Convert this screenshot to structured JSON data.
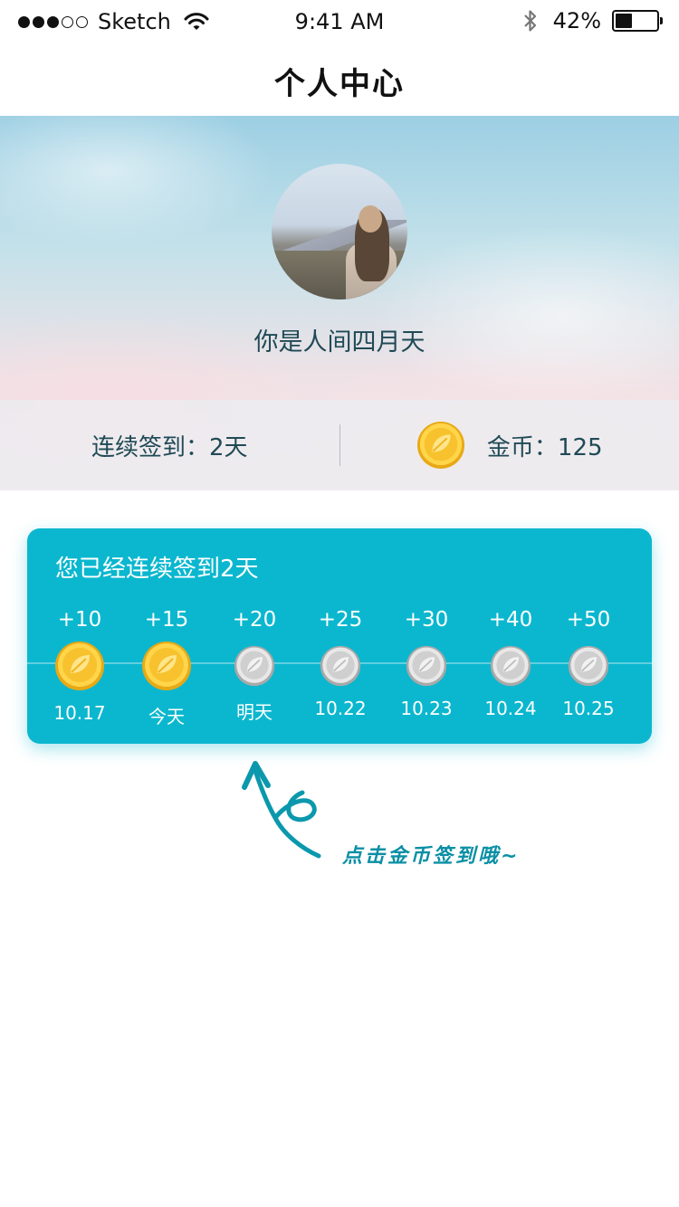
{
  "status_bar": {
    "carrier": "Sketch",
    "time": "9:41 AM",
    "battery": "42%",
    "battery_level": 0.42,
    "signal_bars_filled": 3,
    "signal_bars_total": 5
  },
  "nav": {
    "title": "个人中心"
  },
  "profile": {
    "nickname": "你是人间四月天",
    "checkin_streak_label": "连续签到：2天",
    "coins_label": "金币：125"
  },
  "checkin": {
    "title": "您已经连续签到2天",
    "days": [
      {
        "points": "+10",
        "date": "10.17",
        "claimed": true
      },
      {
        "points": "+15",
        "date": "今天",
        "claimed": true
      },
      {
        "points": "+20",
        "date": "明天",
        "claimed": false
      },
      {
        "points": "+25",
        "date": "10.22",
        "claimed": false
      },
      {
        "points": "+30",
        "date": "10.23",
        "claimed": false
      },
      {
        "points": "+40",
        "date": "10.24",
        "claimed": false
      },
      {
        "points": "+50",
        "date": "10.25",
        "claimed": false
      }
    ]
  },
  "hint": {
    "text": "点击金币签到哦~"
  },
  "colors": {
    "accent": "#0bb7cf",
    "gold": "#f5c431",
    "silver": "#d4d4d4",
    "text_dark": "#1f4a55"
  }
}
